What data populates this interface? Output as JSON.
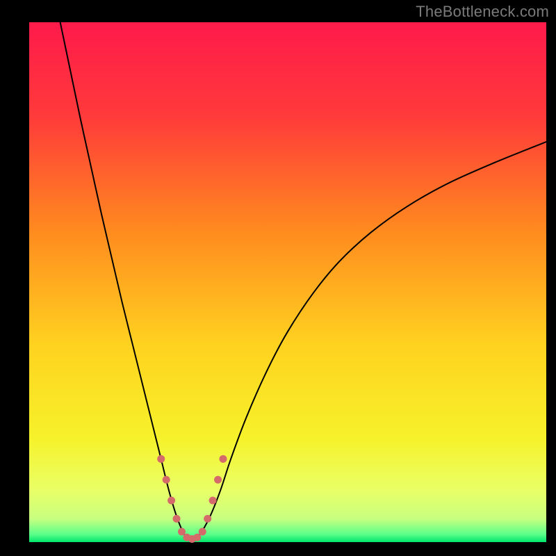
{
  "watermark": "TheBottleneck.com",
  "chart_data": {
    "type": "line",
    "title": "",
    "xlabel": "",
    "ylabel": "",
    "xlim": [
      0,
      100
    ],
    "ylim": [
      0,
      100
    ],
    "grid": false,
    "legend": false,
    "background_gradient": {
      "type": "vertical",
      "stops": [
        {
          "offset": 0.0,
          "color": "#ff1a4b"
        },
        {
          "offset": 0.18,
          "color": "#ff3a3a"
        },
        {
          "offset": 0.4,
          "color": "#ff8a1f"
        },
        {
          "offset": 0.62,
          "color": "#ffd21f"
        },
        {
          "offset": 0.8,
          "color": "#f6f22a"
        },
        {
          "offset": 0.9,
          "color": "#e9ff66"
        },
        {
          "offset": 0.955,
          "color": "#c8ff80"
        },
        {
          "offset": 0.985,
          "color": "#5bff8a"
        },
        {
          "offset": 1.0,
          "color": "#00e56a"
        }
      ]
    },
    "series": [
      {
        "name": "bottleneck-curve",
        "color": "#000000",
        "stroke_width": 2,
        "x": [
          6,
          8,
          10,
          12,
          14,
          16,
          18,
          20,
          22,
          24,
          25.5,
          27,
          28.5,
          30,
          31.5,
          33,
          35,
          37,
          39,
          42,
          46,
          50,
          55,
          60,
          66,
          73,
          81,
          90,
          100
        ],
        "y": [
          100,
          90.5,
          81,
          72,
          63,
          54.5,
          46,
          38,
          30,
          22,
          16,
          10,
          5,
          1.5,
          0.6,
          1.5,
          5,
          10,
          16,
          24,
          33,
          40.5,
          48,
          54,
          59.5,
          64.5,
          69,
          73,
          77
        ]
      },
      {
        "name": "trough-highlight",
        "color": "#d46a6a",
        "stroke_width": 11,
        "linecap": "round",
        "x": [
          25.5,
          26.5,
          27.5,
          28.5,
          29.5,
          30.5,
          31.5,
          32.5,
          33.5,
          34.5,
          35.5,
          36.5,
          37.5
        ],
        "y": [
          16,
          12,
          8,
          4.5,
          2,
          0.9,
          0.6,
          0.9,
          2,
          4.5,
          8,
          12,
          16
        ]
      }
    ]
  }
}
